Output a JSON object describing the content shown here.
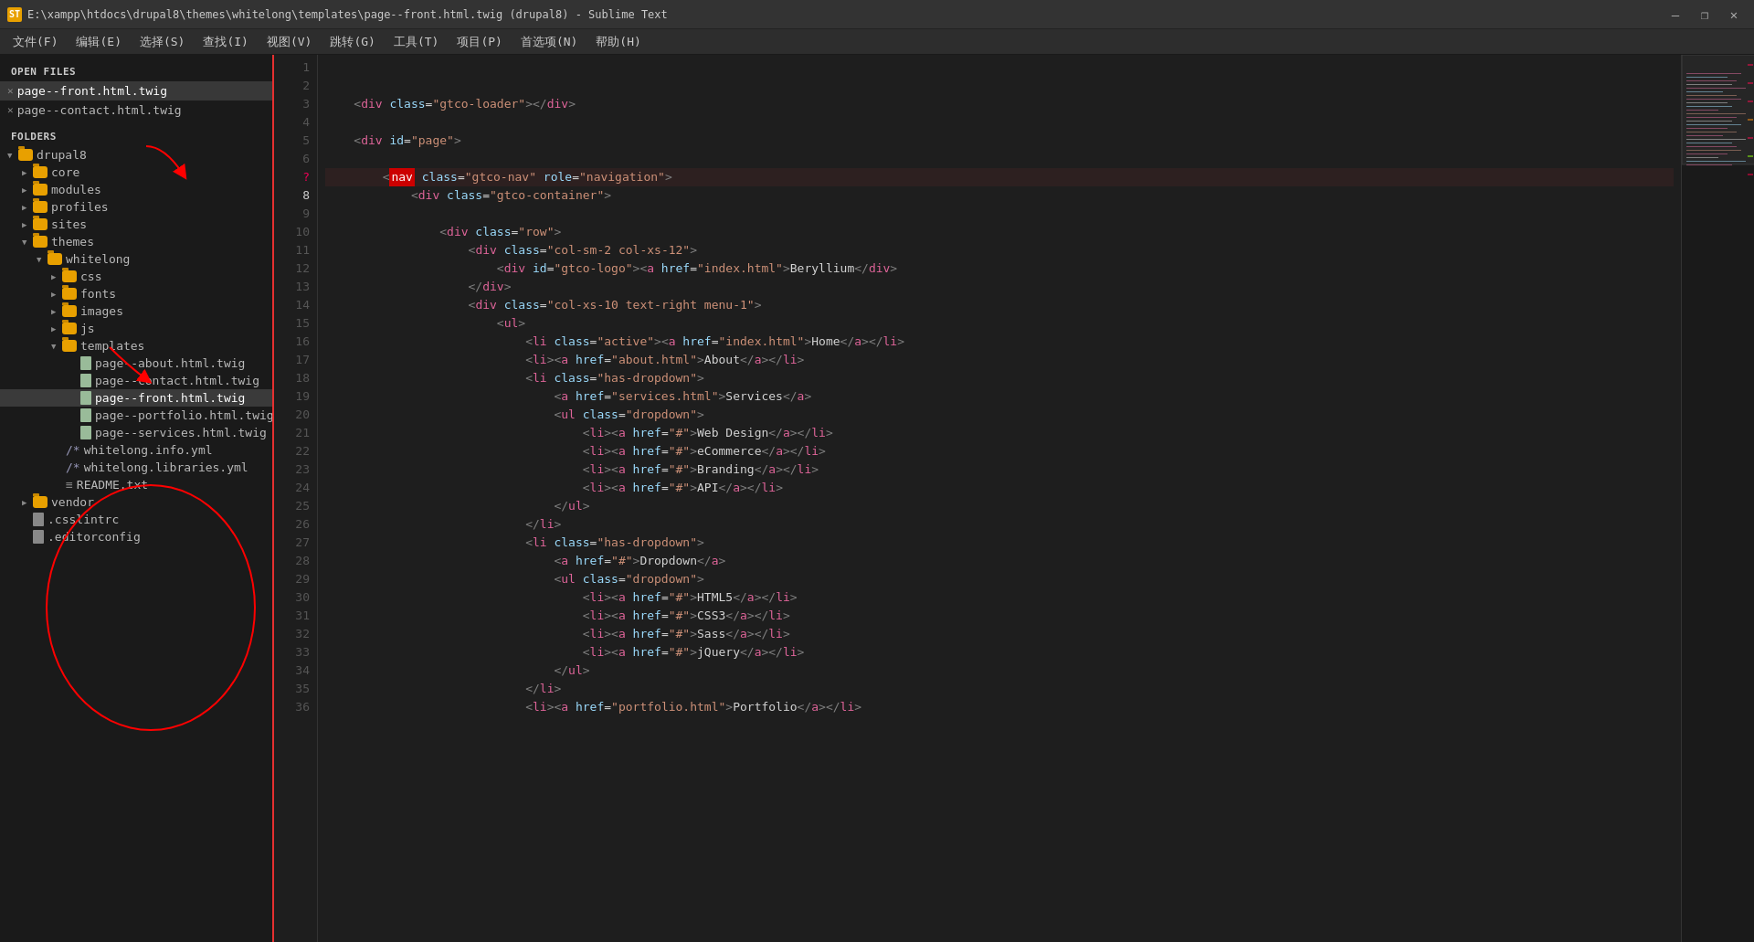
{
  "titlebar": {
    "title": "E:\\xampp\\htdocs\\drupal8\\themes\\whitelong\\templates\\page--front.html.twig (drupal8) - Sublime Text",
    "icon": "ST",
    "controls": [
      "—",
      "❐",
      "✕"
    ]
  },
  "menubar": {
    "items": [
      "文件(F)",
      "编辑(E)",
      "选择(S)",
      "查找(I)",
      "视图(V)",
      "跳转(G)",
      "工具(T)",
      "项目(P)",
      "首选项(N)",
      "帮助(H)"
    ]
  },
  "sidebar": {
    "open_files_label": "OPEN FILES",
    "folders_label": "FOLDERS",
    "open_files": [
      {
        "name": "page--front.html.twig",
        "active": true
      },
      {
        "name": "page--contact.html.twig",
        "active": false
      }
    ],
    "tree": [
      {
        "indent": 0,
        "type": "folder",
        "name": "drupal8",
        "open": true
      },
      {
        "indent": 1,
        "type": "folder",
        "name": "core",
        "open": false
      },
      {
        "indent": 1,
        "type": "folder",
        "name": "modules",
        "open": false
      },
      {
        "indent": 1,
        "type": "folder",
        "name": "profiles",
        "open": false
      },
      {
        "indent": 1,
        "type": "folder",
        "name": "sites",
        "open": false
      },
      {
        "indent": 1,
        "type": "folder",
        "name": "themes",
        "open": true
      },
      {
        "indent": 2,
        "type": "folder",
        "name": "whitelong",
        "open": true
      },
      {
        "indent": 3,
        "type": "folder",
        "name": "css",
        "open": false
      },
      {
        "indent": 3,
        "type": "folder",
        "name": "fonts",
        "open": false
      },
      {
        "indent": 3,
        "type": "folder",
        "name": "images",
        "open": false
      },
      {
        "indent": 3,
        "type": "folder",
        "name": "js",
        "open": false
      },
      {
        "indent": 3,
        "type": "folder",
        "name": "templates",
        "open": true
      },
      {
        "indent": 4,
        "type": "file",
        "name": "page--about.html.twig"
      },
      {
        "indent": 4,
        "type": "file",
        "name": "page--contact.html.twig"
      },
      {
        "indent": 4,
        "type": "file",
        "name": "page--front.html.twig",
        "selected": true
      },
      {
        "indent": 4,
        "type": "file",
        "name": "page--portfolio.html.twig"
      },
      {
        "indent": 4,
        "type": "file",
        "name": "page--services.html.twig"
      },
      {
        "indent": 3,
        "type": "file-yml",
        "name": "whitelong.info.yml"
      },
      {
        "indent": 3,
        "type": "file-yml",
        "name": "whitelong.libraries.yml"
      },
      {
        "indent": 3,
        "type": "file-txt",
        "name": "README.txt"
      },
      {
        "indent": 1,
        "type": "folder",
        "name": "vendor",
        "open": false
      },
      {
        "indent": 1,
        "type": "file-txt",
        "name": ".csslintrc"
      },
      {
        "indent": 1,
        "type": "file-txt",
        "name": ".editorconfig"
      }
    ]
  },
  "editor": {
    "lines": [
      {
        "num": 1,
        "content": ""
      },
      {
        "num": 2,
        "content": ""
      },
      {
        "num": 3,
        "content": "    <div class=\"gtco-loader\"></div>"
      },
      {
        "num": 4,
        "content": ""
      },
      {
        "num": 5,
        "content": "    <div id=\"page\">"
      },
      {
        "num": 6,
        "content": ""
      },
      {
        "num": 7,
        "content": "        <nav class=\"gtco-nav\" role=\"navigation\">",
        "marker": true,
        "active": true
      },
      {
        "num": 8,
        "content": "            <div class=\"gtco-container\">"
      },
      {
        "num": 9,
        "content": ""
      },
      {
        "num": 10,
        "content": "                <div class=\"row\">"
      },
      {
        "num": 11,
        "content": "                    <div class=\"col-sm-2 col-xs-12\">"
      },
      {
        "num": 12,
        "content": "                        <div id=\"gtco-logo\"><a href=\"index.html\">Beryllium</div>"
      },
      {
        "num": 13,
        "content": "                    </div>"
      },
      {
        "num": 14,
        "content": "                    <div class=\"col-xs-10 text-right menu-1\">"
      },
      {
        "num": 15,
        "content": "                        <ul>"
      },
      {
        "num": 16,
        "content": "                            <li class=\"active\"><a href=\"index.html\">Home</a></li>"
      },
      {
        "num": 17,
        "content": "                            <li><a href=\"about.html\">About</a></li>"
      },
      {
        "num": 18,
        "content": "                            <li class=\"has-dropdown\">"
      },
      {
        "num": 19,
        "content": "                                <a href=\"services.html\">Services</a>"
      },
      {
        "num": 20,
        "content": "                                <ul class=\"dropdown\">"
      },
      {
        "num": 21,
        "content": "                                    <li><a href=\"#\">Web Design</a></li>"
      },
      {
        "num": 22,
        "content": "                                    <li><a href=\"#\">eCommerce</a></li>"
      },
      {
        "num": 23,
        "content": "                                    <li><a href=\"#\">Branding</a></li>"
      },
      {
        "num": 24,
        "content": "                                    <li><a href=\"#\">API</a></li>"
      },
      {
        "num": 25,
        "content": "                                </ul>"
      },
      {
        "num": 26,
        "content": "                            </li>"
      },
      {
        "num": 27,
        "content": "                            <li class=\"has-dropdown\">"
      },
      {
        "num": 28,
        "content": "                                <a href=\"#\">Dropdown</a>"
      },
      {
        "num": 29,
        "content": "                                <ul class=\"dropdown\">"
      },
      {
        "num": 30,
        "content": "                                    <li><a href=\"#\">HTML5</a></li>"
      },
      {
        "num": 31,
        "content": "                                    <li><a href=\"#\">CSS3</a></li>"
      },
      {
        "num": 32,
        "content": "                                    <li><a href=\"#\">Sass</a></li>"
      },
      {
        "num": 33,
        "content": "                                    <li><a href=\"#\">jQuery</a></li>"
      },
      {
        "num": 34,
        "content": "                                </ul>"
      },
      {
        "num": 35,
        "content": "                            </li>"
      },
      {
        "num": 36,
        "content": "                            <li><a href=\"portfolio.html\">Portfolio</a></li>"
      }
    ]
  }
}
